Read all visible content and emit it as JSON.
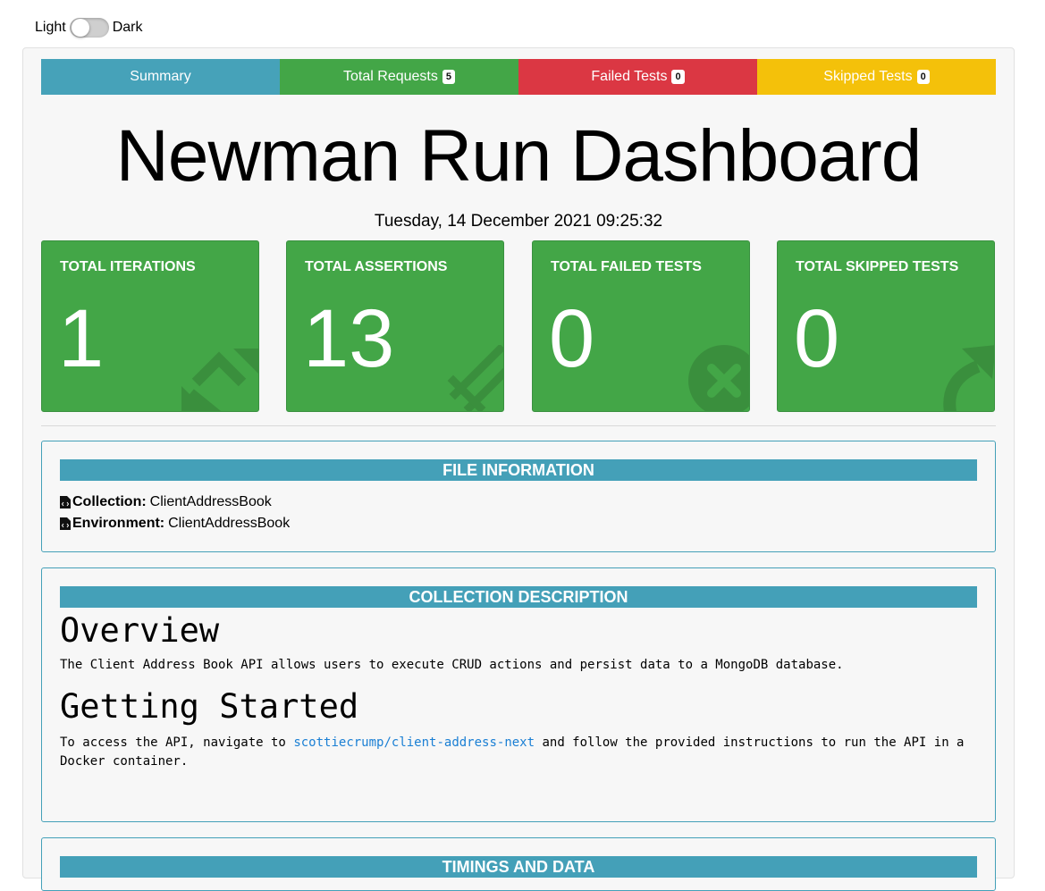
{
  "theme": {
    "light_label": "Light",
    "dark_label": "Dark"
  },
  "tabs": [
    {
      "label": "Summary",
      "badge": "",
      "color": "#46a2b9"
    },
    {
      "label": "Total Requests",
      "badge": "5",
      "color": "#43a647"
    },
    {
      "label": "Failed Tests",
      "badge": "0",
      "color": "#db3743"
    },
    {
      "label": "Skipped Tests",
      "badge": "0",
      "color": "#f4c10a"
    }
  ],
  "title": "Newman Run Dashboard",
  "timestamp": "Tuesday, 14 December 2021 09:25:32",
  "cards": [
    {
      "label": "TOTAL ITERATIONS",
      "value": "1",
      "icon": "sync-icon"
    },
    {
      "label": "TOTAL ASSERTIONS",
      "value": "13",
      "icon": "pencil-icon"
    },
    {
      "label": "TOTAL FAILED TESTS",
      "value": "0",
      "icon": "times-circle-icon"
    },
    {
      "label": "TOTAL SKIPPED TESTS",
      "value": "0",
      "icon": "share-arrow-icon"
    }
  ],
  "file_info": {
    "heading": "FILE INFORMATION",
    "collection_label": "Collection:",
    "collection_value": "ClientAddressBook",
    "environment_label": "Environment:",
    "environment_value": "ClientAddressBook"
  },
  "collection_description": {
    "heading": "COLLECTION DESCRIPTION",
    "overview_heading": "Overview",
    "overview_text": "The Client Address Book API allows users to execute CRUD actions and persist data to a MongoDB database.",
    "getting_started_heading": "Getting Started",
    "gs_text_before": "To access the API, navigate to",
    "gs_link": "scottiecrump/client-address-next",
    "gs_text_after": "and follow the provided instructions to run the API in a Docker container."
  },
  "timings": {
    "heading": "TIMINGS AND DATA"
  },
  "colors": {
    "accent": "#44a0b8",
    "success": "#43a647",
    "danger": "#db3743",
    "warning": "#f4c10a",
    "link": "#1a7fd4"
  }
}
